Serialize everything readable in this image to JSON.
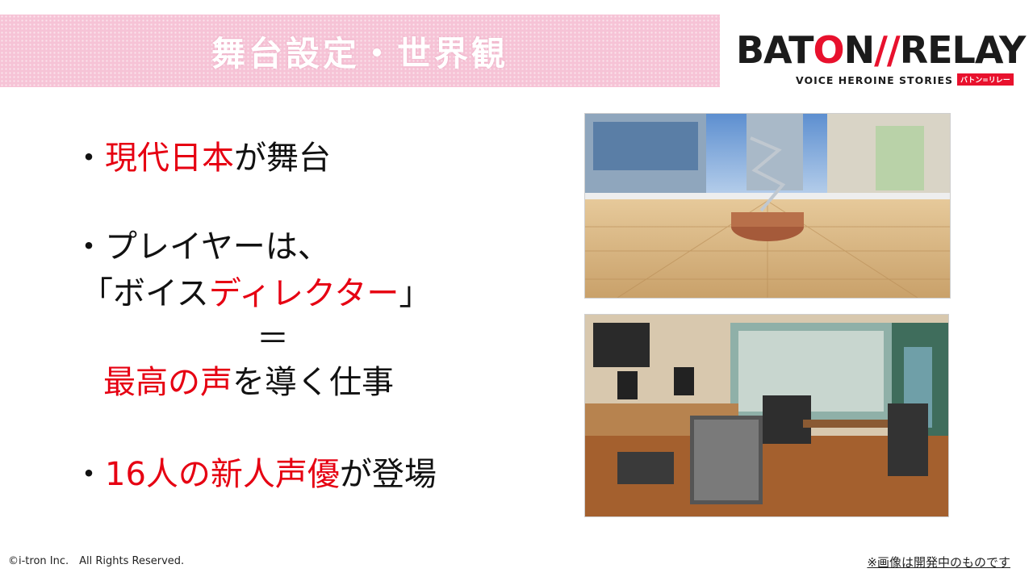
{
  "header": {
    "title": "舞台設定・世界観",
    "logo": {
      "text_before": "BAT",
      "text_o": "O",
      "text_after": "N",
      "slash": "//",
      "text_relay": "RELAY",
      "subtitle": "VOICE HEROINE STORIES",
      "tag": "バトン=リレー"
    }
  },
  "bullets": {
    "b1": {
      "dot": "・",
      "red": "現代日本",
      "rest": "が舞台"
    },
    "b2": {
      "line1": "・プレイヤーは、",
      "line2_open": "「ボイス",
      "line2_red": "ディレクター",
      "line2_close": "」",
      "equals": "＝",
      "line4_red": "最高の声",
      "line4_rest": "を導く仕事"
    },
    "b3": {
      "dot": "・",
      "red": "16人の新人声優",
      "rest": "が登場"
    }
  },
  "images": {
    "plaza": "station-plaza-image",
    "studio": "recording-studio-image"
  },
  "footer": {
    "copyright": "©i-tron Inc.　All Rights Reserved.",
    "note": "※画像は開発中のものです"
  },
  "colors": {
    "accent_red": "#e60012",
    "banner_pink": "#f6c3d6",
    "logo_red": "#e8112d"
  }
}
